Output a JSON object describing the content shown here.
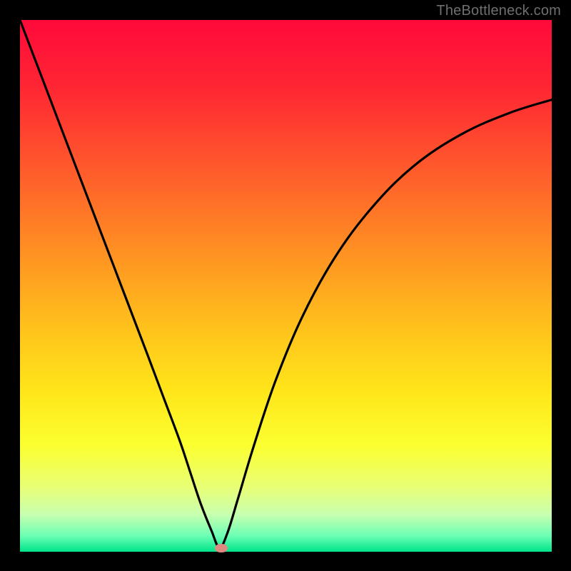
{
  "watermark": {
    "text": "TheBottleneck.com"
  },
  "chart_data": {
    "type": "line",
    "title": "",
    "xlabel": "",
    "ylabel": "",
    "xlim": [
      0,
      100
    ],
    "ylim": [
      0,
      100
    ],
    "gradient_stops": [
      {
        "pct": 0,
        "color": "#ff0a3b"
      },
      {
        "pct": 12,
        "color": "#ff2433"
      },
      {
        "pct": 28,
        "color": "#ff5a2c"
      },
      {
        "pct": 44,
        "color": "#ff9222"
      },
      {
        "pct": 58,
        "color": "#ffc21c"
      },
      {
        "pct": 70,
        "color": "#ffe61a"
      },
      {
        "pct": 80,
        "color": "#fbff30"
      },
      {
        "pct": 88,
        "color": "#e8ff77"
      },
      {
        "pct": 93,
        "color": "#c8ffb0"
      },
      {
        "pct": 97,
        "color": "#6cffb4"
      },
      {
        "pct": 100,
        "color": "#00e38a"
      }
    ],
    "series": [
      {
        "name": "bottleneck-curve",
        "x": [
          0,
          4,
          8,
          12,
          16,
          20,
          24,
          27,
          30,
          32,
          34,
          36,
          37.5,
          39,
          41,
          44,
          48,
          53,
          59,
          66,
          74,
          83,
          92,
          100
        ],
        "y": [
          100,
          89.5,
          79,
          68.5,
          58,
          47.5,
          37,
          29,
          21,
          15,
          9,
          4,
          0.8,
          3.5,
          10,
          20,
          32,
          44,
          55,
          64.5,
          72.5,
          78.5,
          82.5,
          85
        ]
      }
    ],
    "marker": {
      "x": 37.8,
      "y": 0.7,
      "color": "#dd8b80"
    }
  }
}
